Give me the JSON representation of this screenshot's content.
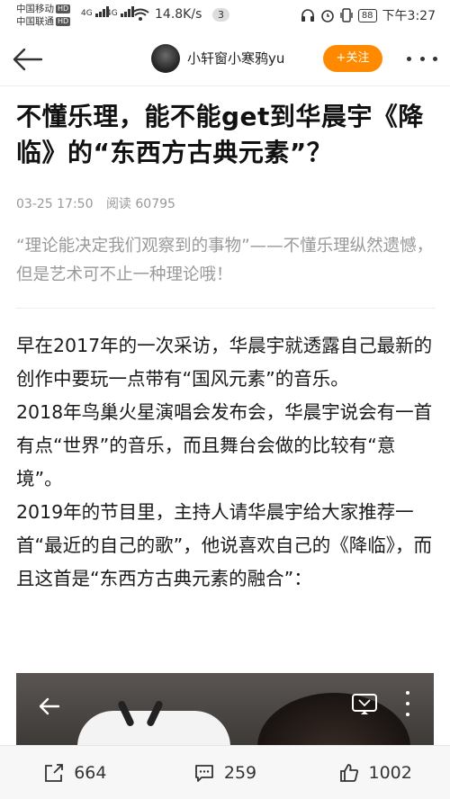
{
  "status_bar": {
    "carrier1": "中国移动",
    "carrier2": "中国联通",
    "hd": "HD",
    "signal1": "4G",
    "signal2": "4G",
    "net_speed": "14.8K/s",
    "notification_count": "3",
    "battery": "88",
    "time": "下午3:27"
  },
  "nav": {
    "author_name": "小轩窗小寒鸦yu",
    "follow_label": "+关注"
  },
  "article": {
    "title": "不懂乐理，能不能get到华晨宇《降临》的“东西方古典元素”？",
    "date": "03-25 17:50",
    "read_label": "阅读",
    "read_count": "60795",
    "quote": "“理论能决定我们观察到的事物”——不懂乐理纵然遗憾，但是艺术可不止一种理论哦！",
    "paragraphs": [
      "早在2017年的一次采访，华晨宇就透露自己最新的创作中要玩一点带有“国风元素”的音乐。",
      "2018年鸟巢火星演唱会发布会，华晨宇说会有一首有点“世界”的音乐，而且舞台会做的比较有“意境”。",
      "2019年的节目里，主持人请华晨宇给大家推荐一首“最近的自己的歌”，他说喜欢自己的《降临》，而且这首是“东西方古典元素的融合”："
    ]
  },
  "bottom_bar": {
    "share_count": "664",
    "comment_count": "259",
    "like_count": "1002"
  },
  "icons": {
    "back": "back-arrow-icon",
    "more": "more-dots-icon",
    "share": "share-icon",
    "comment": "comment-icon",
    "like": "thumbs-up-icon",
    "tv": "tv-cast-icon"
  },
  "colors": {
    "follow_button": "#ff8a00",
    "meta_text": "#999999"
  }
}
